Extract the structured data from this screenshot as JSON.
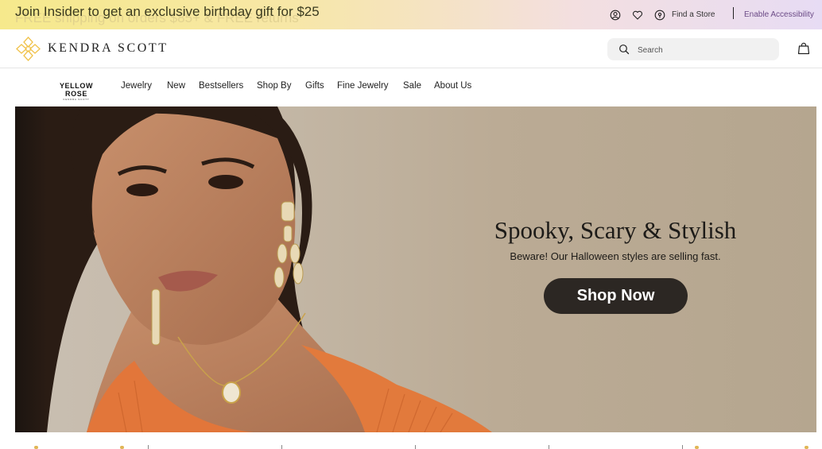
{
  "promo": {
    "message": "Join Insider to get an exclusive birthday gift for $25",
    "ghost_message": "FREE shipping on orders $85+ & FREE returns"
  },
  "utility": {
    "find_store": "Find a Store",
    "accessibility": "Enable Accessibility",
    "icons": [
      "account-icon",
      "heart-icon",
      "location-pin-icon"
    ]
  },
  "header": {
    "brand": "KENDRA SCOTT",
    "search_placeholder": "Search",
    "accent": "#f0c24a"
  },
  "nav": {
    "logo_main": "YELLOW ROSE",
    "logo_sub": "KENDRA SCOTT",
    "items": [
      "Jewelry",
      "New",
      "Bestsellers",
      "Shop By",
      "Gifts",
      "Fine Jewelry",
      "Sale",
      "About Us"
    ]
  },
  "hero": {
    "title": "Spooky, Scary & Stylish",
    "subtitle": "Beware! Our Halloween styles are selling fast.",
    "cta": "Shop Now",
    "cta_color": "#2c2723"
  }
}
